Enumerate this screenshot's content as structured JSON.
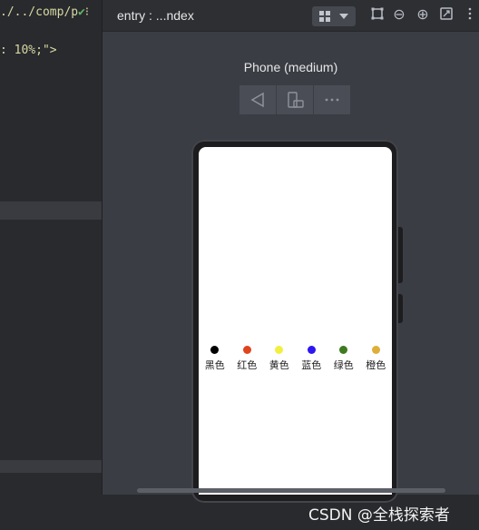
{
  "editor": {
    "line1": "./../comp/p",
    "check": "✔",
    "line1_tail": "⁝",
    "line2": ": 10%;\">"
  },
  "preview": {
    "title": "entry : ...ndex",
    "device_name": "Phone (medium)",
    "header_icons": [
      "layout-grid-icon",
      "dropdown-arrow-icon",
      "crop-icon",
      "zoom-out-icon",
      "zoom-in-icon",
      "fit-screen-icon",
      "more-icon"
    ],
    "toolbar_icons": [
      "rotate-icon",
      "device-icon",
      "more-icon"
    ],
    "more_label": "⋯",
    "zoom_out": "⊖",
    "zoom_in": "⊕"
  },
  "app": {
    "colors": [
      {
        "label": "黑色",
        "color": "#000000"
      },
      {
        "label": "红色",
        "color": "#e0441d"
      },
      {
        "label": "黄色",
        "color": "#f2ef41"
      },
      {
        "label": "蓝色",
        "color": "#2d16f2"
      },
      {
        "label": "绿色",
        "color": "#3e7a1f"
      },
      {
        "label": "橙色",
        "color": "#dfae3a"
      }
    ]
  },
  "watermark": "CSDN @全栈探索者"
}
